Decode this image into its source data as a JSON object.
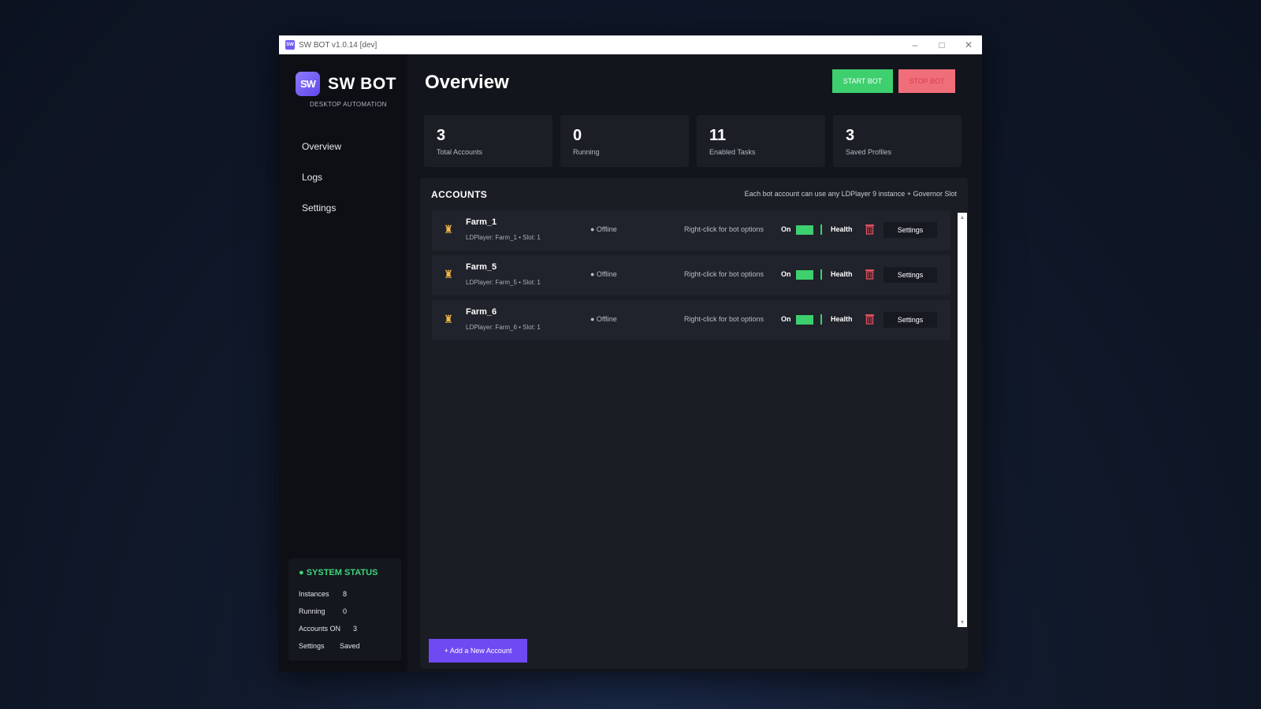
{
  "window": {
    "title": "SW BOT v1.0.14  [dev]",
    "app_icon_text": "SW",
    "controls": {
      "minimize": "–",
      "maximize": "□",
      "close": "✕"
    }
  },
  "brand": {
    "logo_text": "SW",
    "name": "SW BOT",
    "subtitle": "DESKTOP AUTOMATION"
  },
  "nav": [
    {
      "label": "Overview"
    },
    {
      "label": "Logs"
    },
    {
      "label": "Settings"
    }
  ],
  "system_status": {
    "title": "● SYSTEM STATUS",
    "rows": [
      {
        "key": "Instances",
        "value": "8"
      },
      {
        "key": "Running",
        "value": "0"
      },
      {
        "key": "Accounts ON",
        "value": "3"
      },
      {
        "key": "Settings",
        "value": "Saved"
      }
    ]
  },
  "header": {
    "title": "Overview",
    "start_label": "START BOT",
    "stop_label": "STOP BOT"
  },
  "stats": [
    {
      "value": "3",
      "label": "Total Accounts"
    },
    {
      "value": "0",
      "label": "Running"
    },
    {
      "value": "11",
      "label": "Enabled Tasks"
    },
    {
      "value": "3",
      "label": "Saved Profiles"
    }
  ],
  "accounts": {
    "title": "ACCOUNTS",
    "note": "Each bot account can use any LDPlayer 9 instance + Governor Slot",
    "items": [
      {
        "name": "Farm_1",
        "meta": "LDPlayer: Farm_1   •   Slot: 1",
        "status": "● Offline",
        "hint": "Right-click for bot options",
        "on_label": "On",
        "health_label": "Health",
        "settings_label": "Settings"
      },
      {
        "name": "Farm_5",
        "meta": "LDPlayer: Farm_5   •   Slot: 1",
        "status": "● Offline",
        "hint": "Right-click for bot options",
        "on_label": "On",
        "health_label": "Health",
        "settings_label": "Settings"
      },
      {
        "name": "Farm_6",
        "meta": "LDPlayer: Farm_6   •   Slot: 1",
        "status": "● Offline",
        "hint": "Right-click for bot options",
        "on_label": "On",
        "health_label": "Health",
        "settings_label": "Settings"
      }
    ],
    "add_label": "+   Add a New Account"
  },
  "colors": {
    "accent": "#6f4af3",
    "success": "#3ecf6e",
    "danger": "#f06e7a"
  },
  "icons": {
    "account": "chess-rook-icon",
    "delete": "trash-icon"
  }
}
